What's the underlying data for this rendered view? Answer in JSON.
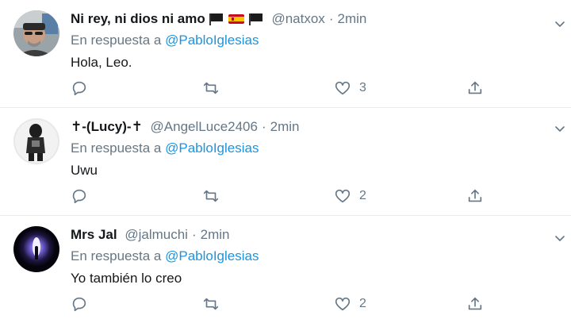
{
  "tweets": [
    {
      "display_name": "Ni rey, ni dios ni amo",
      "emojis": [
        "black-flag-icon",
        "spain-flag-icon",
        "black-flag-icon"
      ],
      "handle": "@natxox",
      "separator": "·",
      "time": "2min",
      "reply_prefix": "En respuesta a",
      "reply_to": "@PabloIglesias",
      "text": "Hola, Leo.",
      "likes": "3",
      "retweets": "",
      "replies": "",
      "avatar_icon": "man-with-sunglasses-avatar"
    },
    {
      "display_name": "✝-(Lucy)-✝",
      "emojis": [],
      "handle": "@AngelLuce2406",
      "separator": "·",
      "time": "2min",
      "reply_prefix": "En respuesta a",
      "reply_to": "@PabloIglesias",
      "text": "Uwu",
      "likes": "2",
      "retweets": "",
      "replies": "",
      "avatar_icon": "dark-figure-avatar"
    },
    {
      "display_name": "Mrs Jal",
      "emojis": [],
      "handle": "@jalmuchi",
      "separator": "·",
      "time": "2min",
      "reply_prefix": "En respuesta a",
      "reply_to": "@PabloIglesias",
      "text": "Yo también lo creo",
      "likes": "2",
      "retweets": "",
      "replies": "",
      "avatar_icon": "space-portal-avatar"
    }
  ],
  "colors": {
    "link": "#1b95e0",
    "secondary_text": "#657786",
    "divider": "#e6ecf0"
  },
  "icons": {
    "reply": "reply-icon",
    "retweet": "retweet-icon",
    "like": "heart-icon",
    "share": "share-icon",
    "more": "chevron-down-icon"
  }
}
